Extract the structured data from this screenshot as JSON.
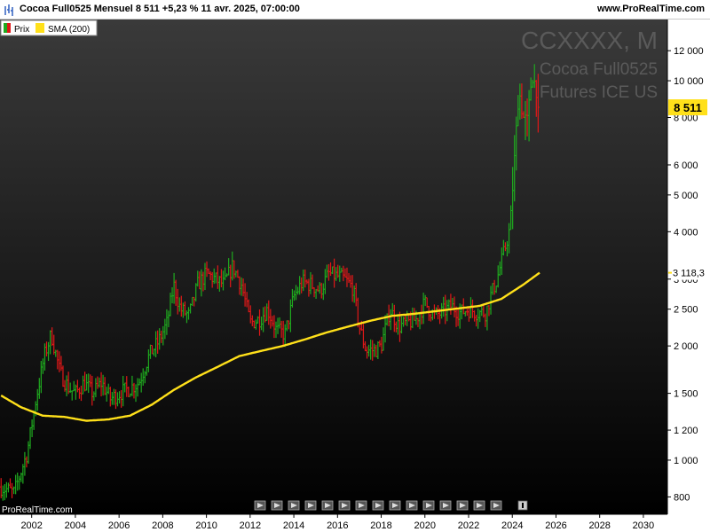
{
  "header": {
    "title": "Cocoa Full0525 Mensuel 8 511 +5,23 % 11 avr. 2025, 07:00:00",
    "brand": "www.ProRealTime.com"
  },
  "legend": {
    "price_label": "Prix",
    "sma_label": "SMA (200)"
  },
  "watermark": {
    "symbol": "CCXXXX, M",
    "line1": "Cocoa Full0525",
    "line2": "Futures ICE US"
  },
  "footer": {
    "brand": "ProRealTime.com"
  },
  "colors": {
    "up": "#1faa1f",
    "down": "#e01818",
    "sma": "#ffe01a",
    "price_badge": "#ffe01a"
  },
  "chart_data": {
    "type": "bar",
    "scale": "log",
    "ylim": [
      720,
      14500
    ],
    "xlim": [
      2000.55,
      2031.1
    ],
    "y_ticks": [
      {
        "value": 800,
        "label": "800"
      },
      {
        "value": 1000,
        "label": "1 000"
      },
      {
        "value": 1200,
        "label": "1 200"
      },
      {
        "value": 1500,
        "label": "1 500"
      },
      {
        "value": 2000,
        "label": "2 000"
      },
      {
        "value": 2500,
        "label": "2 500"
      },
      {
        "value": 3000,
        "label": "3 000"
      },
      {
        "value": 4000,
        "label": "4 000"
      },
      {
        "value": 5000,
        "label": "5 000"
      },
      {
        "value": 6000,
        "label": "6 000"
      },
      {
        "value": 8000,
        "label": "8 000"
      },
      {
        "value": 10000,
        "label": "10 000"
      },
      {
        "value": 12000,
        "label": "12 000"
      }
    ],
    "x_ticks": [
      "2002",
      "2004",
      "2006",
      "2008",
      "2010",
      "2012",
      "2014",
      "2016",
      "2018",
      "2020",
      "2022",
      "2024",
      "2026",
      "2028",
      "2030"
    ],
    "last_price": {
      "value": 8511,
      "label": "8 511"
    },
    "sma_last": {
      "value": 3118.3,
      "label": "3 118,3"
    },
    "price_anchors": [
      [
        2000.6,
        850
      ],
      [
        2001.2,
        820
      ],
      [
        2001.8,
        1050
      ],
      [
        2002.2,
        1450
      ],
      [
        2002.6,
        1900
      ],
      [
        2002.9,
        2150
      ],
      [
        2003.3,
        1700
      ],
      [
        2003.7,
        1550
      ],
      [
        2004.0,
        1500
      ],
      [
        2004.4,
        1600
      ],
      [
        2004.8,
        1500
      ],
      [
        2005.2,
        1600
      ],
      [
        2005.6,
        1450
      ],
      [
        2006.0,
        1500
      ],
      [
        2006.5,
        1550
      ],
      [
        2006.9,
        1600
      ],
      [
        2007.4,
        1900
      ],
      [
        2007.8,
        2050
      ],
      [
        2008.2,
        2300
      ],
      [
        2008.5,
        2900
      ],
      [
        2008.8,
        2500
      ],
      [
        2009.2,
        2400
      ],
      [
        2009.6,
        2900
      ],
      [
        2010.0,
        3100
      ],
      [
        2010.4,
        3000
      ],
      [
        2010.8,
        2900
      ],
      [
        2011.2,
        3250
      ],
      [
        2011.6,
        2900
      ],
      [
        2012.0,
        2300
      ],
      [
        2012.4,
        2350
      ],
      [
        2012.8,
        2500
      ],
      [
        2013.2,
        2200
      ],
      [
        2013.6,
        2150
      ],
      [
        2014.0,
        2700
      ],
      [
        2014.4,
        2950
      ],
      [
        2014.8,
        2900
      ],
      [
        2015.2,
        2800
      ],
      [
        2015.6,
        3100
      ],
      [
        2016.0,
        3050
      ],
      [
        2016.3,
        3000
      ],
      [
        2016.7,
        2850
      ],
      [
        2017.0,
        2250
      ],
      [
        2017.3,
        1950
      ],
      [
        2017.7,
        1950
      ],
      [
        2018.0,
        2000
      ],
      [
        2018.4,
        2500
      ],
      [
        2018.8,
        2250
      ],
      [
        2019.2,
        2300
      ],
      [
        2019.6,
        2350
      ],
      [
        2020.0,
        2600
      ],
      [
        2020.4,
        2400
      ],
      [
        2020.8,
        2450
      ],
      [
        2021.2,
        2550
      ],
      [
        2021.6,
        2450
      ],
      [
        2022.0,
        2500
      ],
      [
        2022.4,
        2450
      ],
      [
        2022.8,
        2450
      ],
      [
        2023.0,
        2700
      ],
      [
        2023.3,
        3000
      ],
      [
        2023.6,
        3500
      ],
      [
        2023.9,
        4100
      ],
      [
        2024.1,
        6200
      ],
      [
        2024.3,
        9500
      ],
      [
        2024.5,
        8000
      ],
      [
        2024.7,
        7800
      ],
      [
        2024.9,
        10500
      ],
      [
        2025.1,
        9500
      ],
      [
        2025.25,
        8511
      ]
    ],
    "sma_anchors": [
      [
        2000.6,
        1480
      ],
      [
        2001.5,
        1380
      ],
      [
        2002.5,
        1310
      ],
      [
        2003.5,
        1300
      ],
      [
        2004.5,
        1270
      ],
      [
        2005.5,
        1280
      ],
      [
        2006.5,
        1310
      ],
      [
        2007.5,
        1400
      ],
      [
        2008.5,
        1530
      ],
      [
        2009.5,
        1650
      ],
      [
        2010.5,
        1760
      ],
      [
        2011.5,
        1880
      ],
      [
        2012.5,
        1940
      ],
      [
        2013.5,
        2000
      ],
      [
        2014.5,
        2080
      ],
      [
        2015.5,
        2170
      ],
      [
        2016.5,
        2250
      ],
      [
        2017.5,
        2330
      ],
      [
        2018.5,
        2400
      ],
      [
        2019.5,
        2430
      ],
      [
        2020.5,
        2470
      ],
      [
        2021.5,
        2510
      ],
      [
        2022.5,
        2550
      ],
      [
        2023.5,
        2660
      ],
      [
        2024.5,
        2900
      ],
      [
        2025.25,
        3118.3
      ]
    ]
  }
}
